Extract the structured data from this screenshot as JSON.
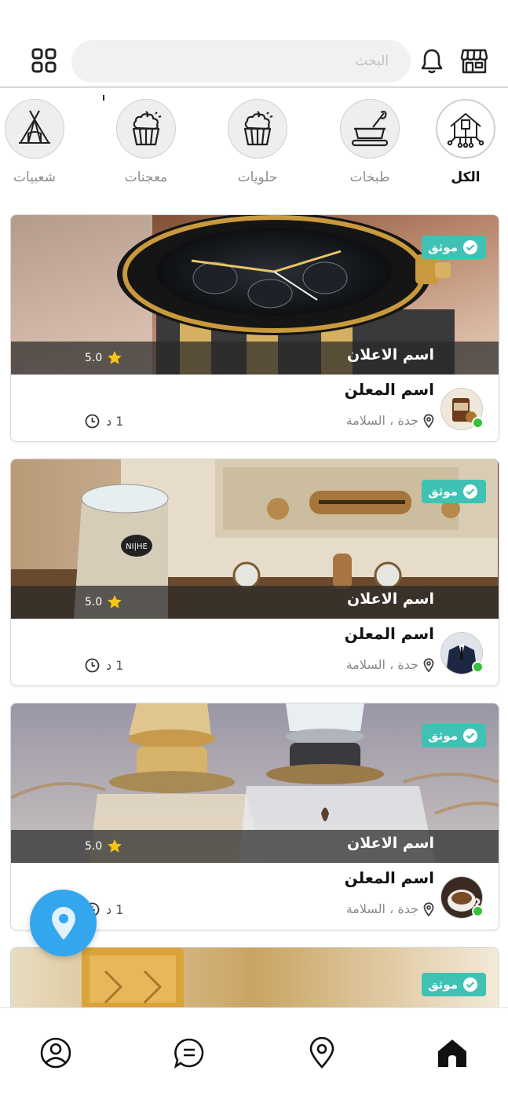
{
  "search": {
    "placeholder": "البحث"
  },
  "categories": [
    {
      "label": "الكل",
      "icon": "smart-home-icon",
      "active": true
    },
    {
      "label": "طبخات",
      "icon": "cooking-bowl-icon",
      "active": false
    },
    {
      "label": "حلويات",
      "icon": "cupcake-icon",
      "active": false
    },
    {
      "label": "معجنات",
      "icon": "cupcake-icon",
      "active": false
    },
    {
      "label": "شعبيات",
      "icon": "tent-icon",
      "active": false
    }
  ],
  "cards": [
    {
      "badge": "موثق",
      "title": "اسم الاعلان",
      "rating": "5.0",
      "advertiser": "اسم المعلن",
      "location": "جدة ، السلامة",
      "time": "1 د",
      "image": "watch"
    },
    {
      "badge": "موثق",
      "title": "اسم الاعلان",
      "rating": "5.0",
      "advertiser": "اسم المعلن",
      "location": "جدة ، السلامة",
      "time": "1 د",
      "image": "coffee-machine"
    },
    {
      "badge": "موثق",
      "title": "اسم الاعلان",
      "rating": "5.0",
      "advertiser": "اسم المعلن",
      "location": "جدة ، السلامة",
      "time": "1 د",
      "image": "perfume"
    },
    {
      "badge": "موثق",
      "image": "oil-bottle"
    }
  ],
  "nav": [
    "home-icon",
    "map-pin-icon",
    "chat-icon",
    "profile-icon"
  ],
  "colors": {
    "badge": "#3fc2b3",
    "fab": "#33a6ee",
    "online": "#35c23b",
    "star": "#f5c518"
  }
}
